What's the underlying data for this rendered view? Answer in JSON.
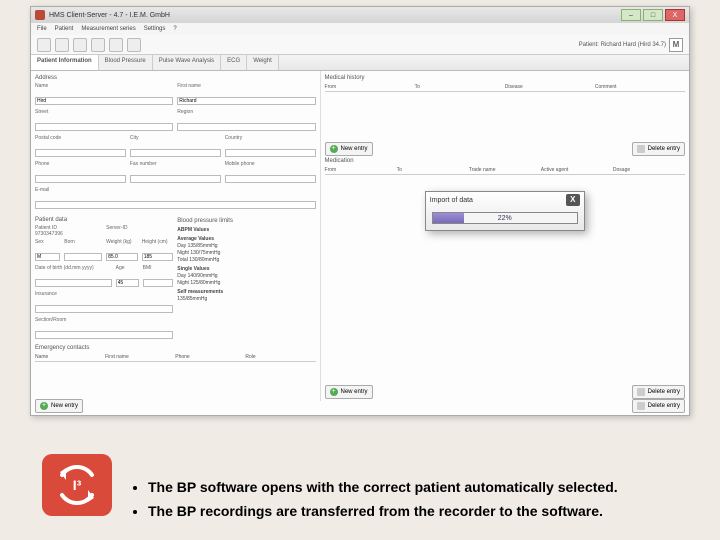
{
  "window": {
    "title": "HMS Client-Server - 4.7 - I.E.M. GmbH",
    "patient_badge": "Patient: Richard Hard (Hird 34.7)",
    "badge_letter": "M"
  },
  "menu": [
    "File",
    "Patient",
    "Measurement series",
    "Settings",
    "?"
  ],
  "tabs": [
    "Patient Information",
    "Blood Pressure",
    "Pulse Wave Analysis",
    "ECG",
    "Weight"
  ],
  "address": {
    "section": "Address",
    "name": "Name",
    "name_val": "Hird",
    "first": "First name",
    "first_val": "Richard",
    "street": "Street",
    "region": "Region",
    "postal": "Postal code",
    "city": "City",
    "phone": "Phone",
    "fax": "Fax number",
    "mobile": "Mobile phone",
    "email": "E-mail"
  },
  "patient_data": {
    "section": "Patient data",
    "id_lbl": "Patient ID",
    "id_val": "9730347396",
    "server_lbl": "Server-ID",
    "sex_lbl": "Sex",
    "born_lbl": "Born",
    "weight_lbl": "Weight (kg)",
    "height_lbl": "Height (cm)",
    "sex_val": "M",
    "weight_val": "85.0",
    "height_val": "185",
    "dob_lbl": "Date of birth (dd.mm.yyyy)",
    "age_lbl": "Age",
    "bmi_lbl": "BMI",
    "age_val": "45",
    "insurance": "Insurance",
    "dept": "Section/Room"
  },
  "bp_limits": {
    "section": "Blood pressure limits",
    "abpm_hdr": "ABPM Values",
    "avg_hdr": "Average Values",
    "day": "Day",
    "day_val": "135/85mmHg",
    "night": "Night",
    "night_val": "130/75mmHg",
    "total": "Total",
    "total_val": "130/80mmHg",
    "single_hdr": "Single Values",
    "s_day": "Day",
    "s_day_val": "140/90mmHg",
    "s_night": "Night",
    "s_night_val": "125/80mmHg",
    "self_hdr": "Self measurements",
    "self_val": "135/85mmHg"
  },
  "emergency": {
    "section": "Emergency contacts",
    "cols": [
      "Name",
      "First name",
      "Phone",
      "Role"
    ]
  },
  "medical_history": {
    "section": "Medical history",
    "cols": [
      "From",
      "To",
      "Disease",
      "Comment"
    ]
  },
  "medication": {
    "section": "Medication",
    "cols": [
      "From",
      "To",
      "Trade name",
      "Active agent",
      "Dosage"
    ]
  },
  "buttons": {
    "new_entry": "New entry",
    "delete_entry": "Delete entry"
  },
  "dialog": {
    "title": "Import of data",
    "percent": "22%"
  },
  "notes": {
    "line1": "The BP software opens with the correct patient automatically selected.",
    "line2": "The BP recordings are transferred from the recorder to the software."
  }
}
